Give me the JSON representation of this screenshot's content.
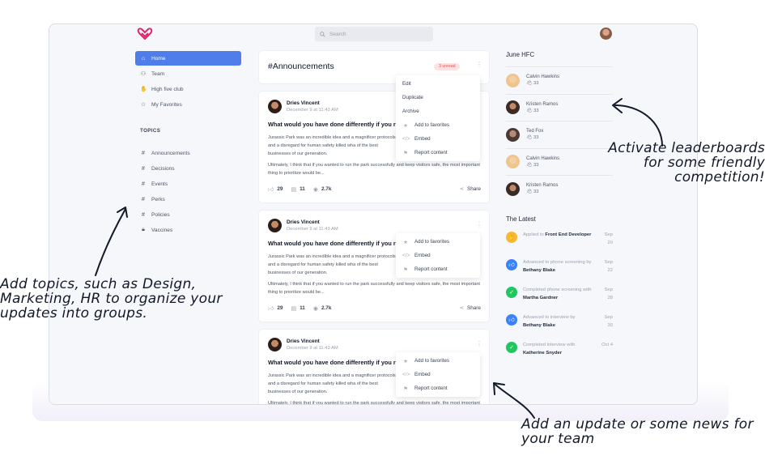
{
  "search": {
    "placeholder": "Search"
  },
  "nav": {
    "items": [
      {
        "label": "Home",
        "icon": "home-icon",
        "active": true
      },
      {
        "label": "Team",
        "icon": "team-icon"
      },
      {
        "label": "High five club",
        "icon": "hand-icon"
      },
      {
        "label": "My Favorites",
        "icon": "star-icon"
      }
    ],
    "topics_title": "TOPICS",
    "topics": [
      {
        "label": "Announcements",
        "icon": "hash-icon"
      },
      {
        "label": "Decisions",
        "icon": "hash-icon"
      },
      {
        "label": "Events",
        "icon": "hash-icon"
      },
      {
        "label": "Perks",
        "icon": "hash-icon"
      },
      {
        "label": "Policies",
        "icon": "hash-icon"
      },
      {
        "label": "Vaccines",
        "icon": "lock-icon"
      }
    ]
  },
  "announcements": {
    "title": "#Announcements",
    "badge": "3 unread"
  },
  "top_menu": [
    "Edit",
    "Duplicate",
    "Archive",
    "Add to favorites",
    "Embed",
    "Report content"
  ],
  "post_menu": [
    "Add to favorites",
    "Embed",
    "Report content"
  ],
  "posts": [
    {
      "author": "Dries Vincent",
      "time": "December 9 at 11:43 AM",
      "question": "What would you have done differently if you ra",
      "body1": "Jurassic Park was an incredible idea and a magnificer protocols and a disregard for human safety killed wha of the best businesses of our generation.",
      "body2": "Ultimately, I think that if you wanted to run the park successfully and keep visitors safe, the most important thing to prioritize would be...",
      "likes": "29",
      "comments": "11",
      "views": "2.7k",
      "share": "Share"
    },
    {
      "author": "Dries Vincent",
      "time": "December 9 at 11:43 AM",
      "question": "What would you have done differently if you ra",
      "body1": "Jurassic Park was an incredible idea and a magnificer protocols and a disregard for human safety killed wha of the best businesses of our generation.",
      "body2": "Ultimately, I think that if you wanted to run the park successfully and keep visitors safe, the most important thing to prioritize would be...",
      "likes": "29",
      "comments": "11",
      "views": "2.7k",
      "share": "Share"
    },
    {
      "author": "Dries Vincent",
      "time": "December 9 at 11:43 AM",
      "question": "What would you have done differently if you ra",
      "body1": "Jurassic Park was an incredible idea and a magnificer protocols and a disregard for human safety killed wha of the best businesses of our generation.",
      "body2": "Ultimately, I think that if you wanted to run the park successfully and keep visitors safe, the most important thing to prioritize would be..."
    }
  ],
  "hfc": {
    "title": "June HFC",
    "people": [
      {
        "name": "Calvin Hawkins",
        "points": "33",
        "color": "#f0c48a"
      },
      {
        "name": "Kristen Ramos",
        "points": "33",
        "color": "#3b2b25"
      },
      {
        "name": "Ted Fox",
        "points": "33",
        "color": "#4a3a33"
      },
      {
        "name": "Calvin Hawkins",
        "points": "33",
        "color": "#f0c48a"
      },
      {
        "name": "Kristen Ramos",
        "points": "33",
        "color": "#3b2b25"
      }
    ]
  },
  "latest": {
    "title": "The Latest",
    "items": [
      {
        "pre": "Applied to ",
        "bold": "Front End Developer",
        "post": "",
        "date": "Sep 20",
        "icon": "hand-icon",
        "color": "#f5b82e"
      },
      {
        "pre": "Advanced to phone screening by ",
        "bold": "Bethany Blake",
        "post": "",
        "date": "Sep 22",
        "icon": "thumb-up-icon",
        "color": "#3b82f6"
      },
      {
        "pre": "Completed phone screening with ",
        "bold": "Martha Gardner",
        "post": "",
        "date": "Sep 28",
        "icon": "check-icon",
        "color": "#22c55e"
      },
      {
        "pre": "Advanced to interview by ",
        "bold": "Bethany Blake",
        "post": "",
        "date": "Sep 30",
        "icon": "thumb-up-icon",
        "color": "#3b82f6"
      },
      {
        "pre": "Completed interview with ",
        "bold": "Katherine Snyder",
        "post": "",
        "date": "Oct 4",
        "icon": "check-icon",
        "color": "#22c55e"
      }
    ]
  },
  "annotations": {
    "topics": "Add topics, such as Design, Marketing, HR to organize your updates into groups.",
    "leaderboards": "Activate leaderboards for some friendly competition!",
    "update": "Add an update or some news for your team"
  }
}
